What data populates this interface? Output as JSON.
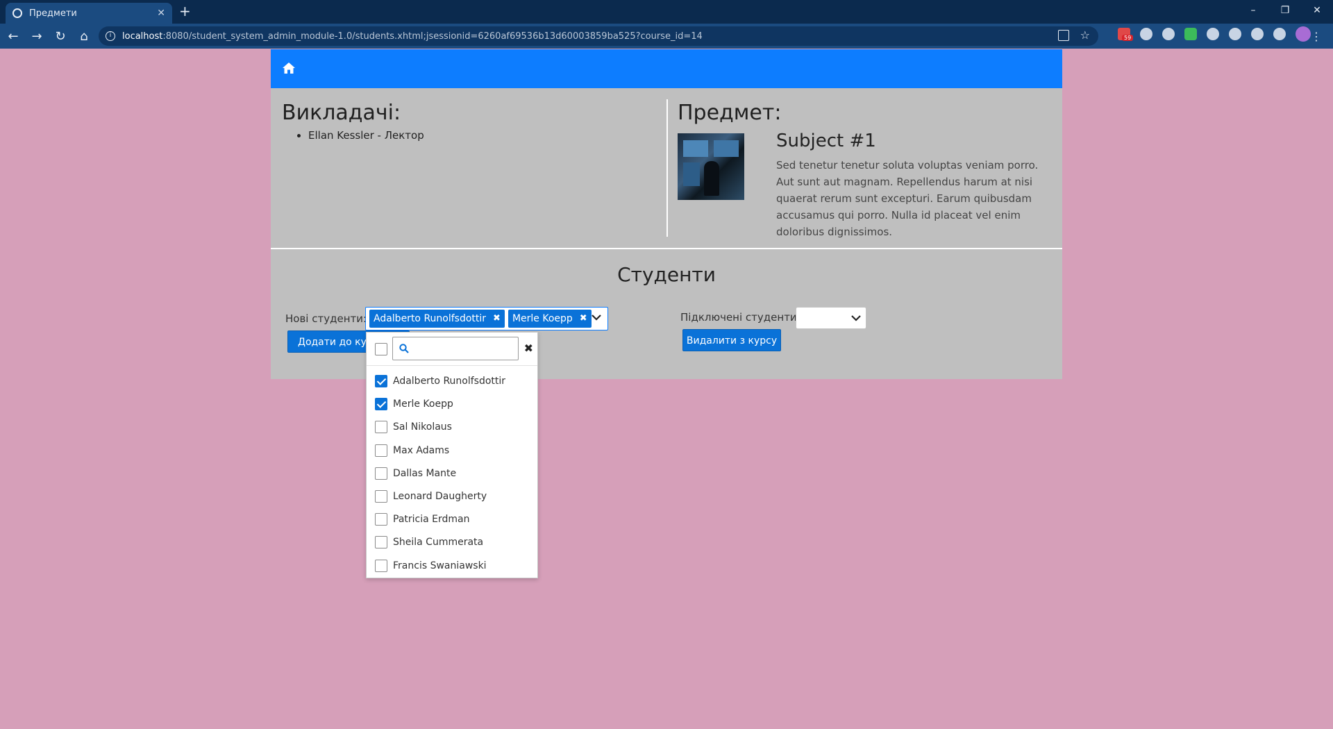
{
  "browser": {
    "tab_title": "Предмети",
    "tab_close": "✕",
    "new_tab": "+",
    "url_host": "localhost",
    "url_rest": ":8080/student_system_admin_module-1.0/students.xhtml;jsessionid=6260af69536b13d60003859ba525?course_id=14",
    "ext_badge": "59",
    "window_controls": [
      "–",
      "❐",
      "✕"
    ]
  },
  "teachers": {
    "heading": "Викладачі:",
    "items": [
      "Ellan Kessler - Лектор"
    ]
  },
  "subject": {
    "heading": "Предмет:",
    "name": "Subject #1",
    "description": "Sed tenetur tenetur soluta voluptas veniam porro. Aut sunt aut magnam. Repellendus harum at nisi quaerat rerum sunt excepturi. Earum quibusdam accusamus qui porro. Nulla id placeat vel enim doloribus dignissimos."
  },
  "students": {
    "heading": "Студенти",
    "new_label": "Нові студенти:",
    "selected_chips": [
      "Adalberto Runolfsdottir",
      "Merle Koepp"
    ],
    "chip_remove": "✖",
    "connected_label": "Підключені студенти:",
    "add_button": "Додати до курсу",
    "remove_button": "Видалити з курсу"
  },
  "dropdown": {
    "search_placeholder": "",
    "close": "✖",
    "options": [
      {
        "label": "Adalberto Runolfsdottir",
        "checked": true
      },
      {
        "label": "Merle Koepp",
        "checked": true
      },
      {
        "label": "Sal Nikolaus",
        "checked": false
      },
      {
        "label": "Max Adams",
        "checked": false
      },
      {
        "label": "Dallas Mante",
        "checked": false
      },
      {
        "label": "Leonard Daugherty",
        "checked": false
      },
      {
        "label": "Patricia Erdman",
        "checked": false
      },
      {
        "label": "Sheila Cummerata",
        "checked": false
      },
      {
        "label": "Francis Swaniawski",
        "checked": false
      }
    ]
  },
  "colors": {
    "background": "#d69fb9",
    "navbar": "#0d7dff",
    "panel": "#bfbfbf",
    "accent": "#0a72d8"
  }
}
